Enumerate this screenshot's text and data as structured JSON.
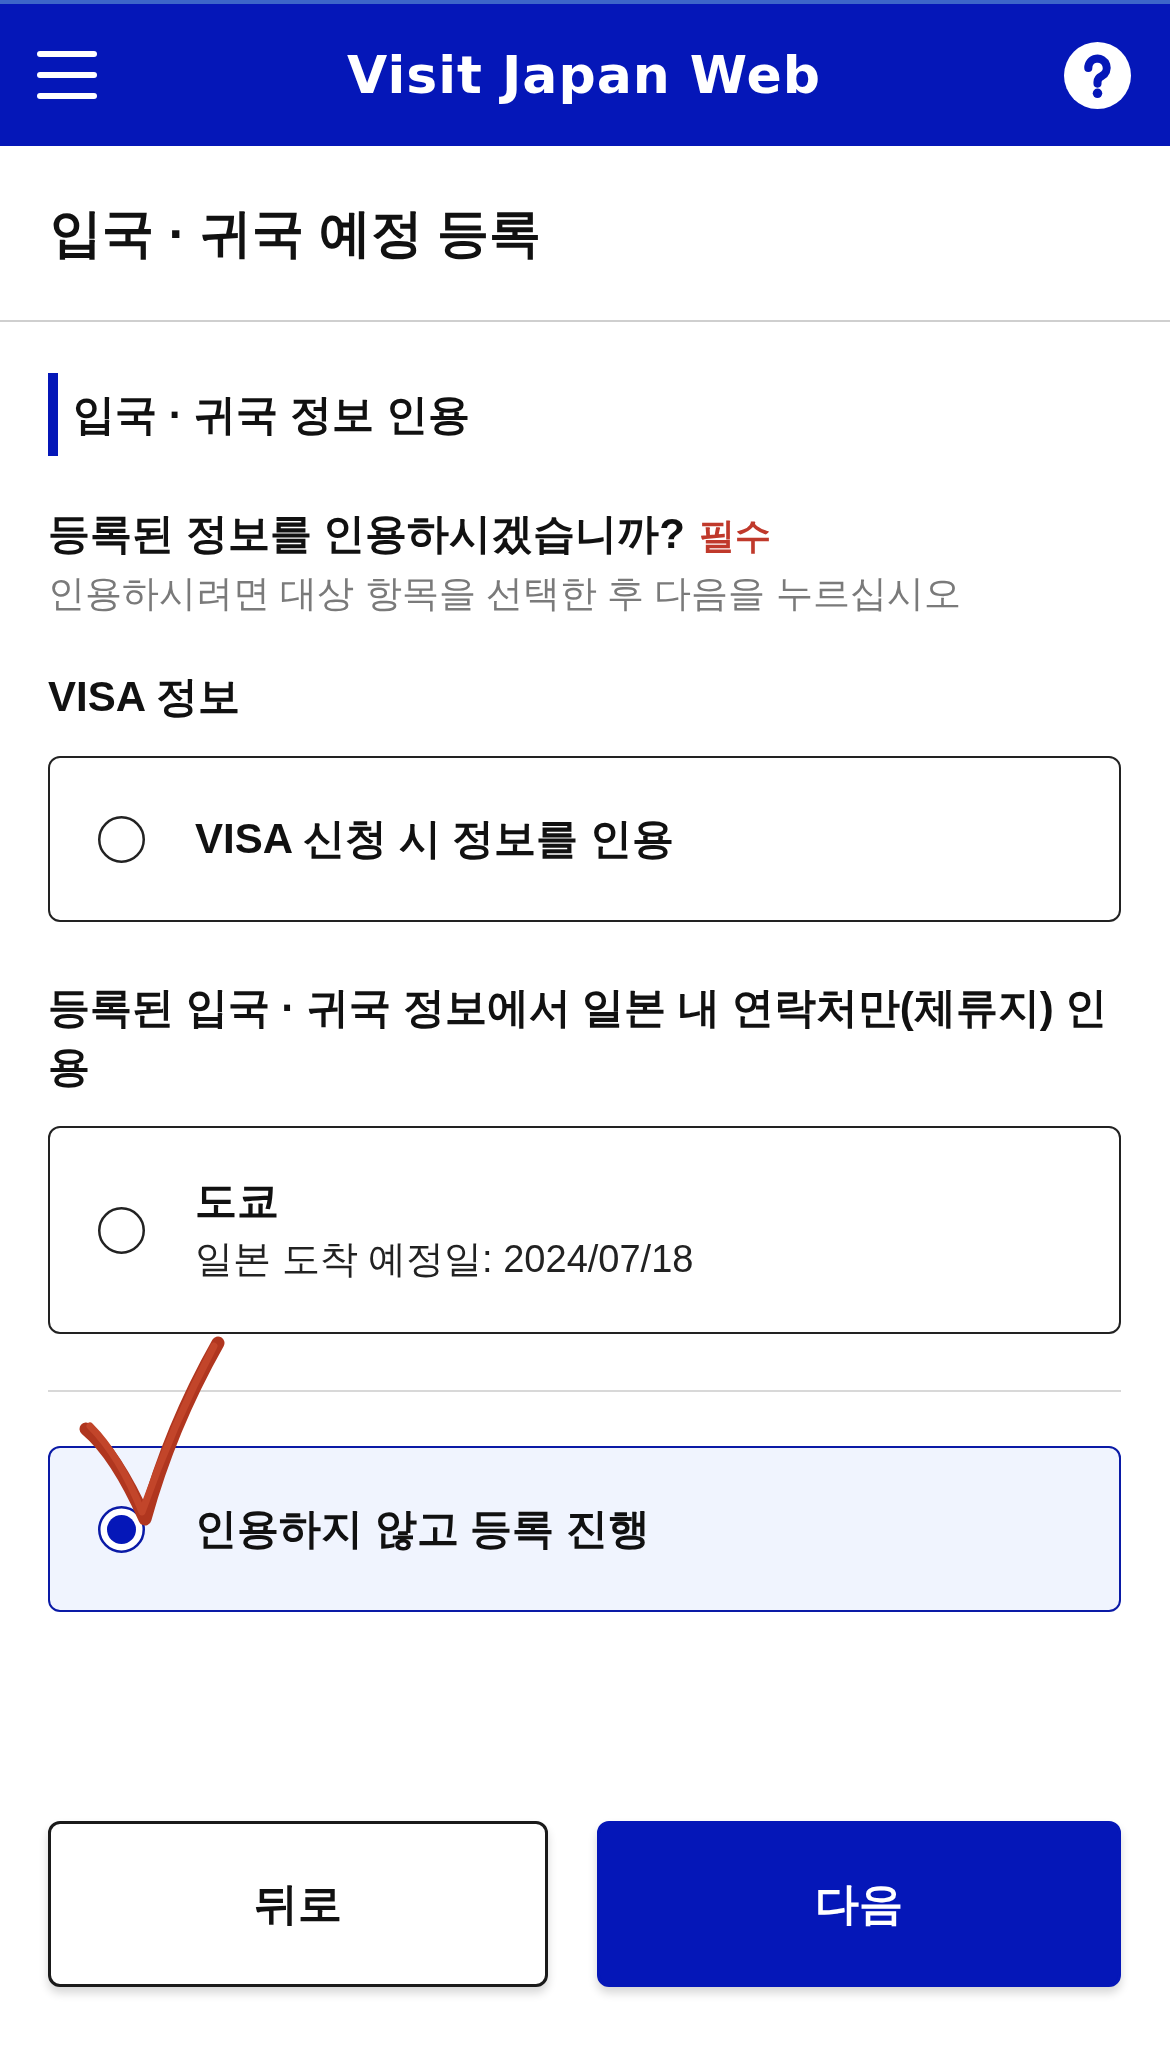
{
  "header": {
    "title": "Visit Japan Web"
  },
  "page_title": "입국 · 귀국 예정 등록",
  "section": {
    "heading": "입국 · 귀국 정보 인용",
    "question": "등록된 정보를 인용하시겠습니까?",
    "required_label": "필수",
    "hint": "인용하시려면 대상 항목을 선택한 후 다음을 누르십시오"
  },
  "groups": [
    {
      "label": "VISA 정보",
      "options": [
        {
          "title": "VISA 신청 시 정보를 인용",
          "selected": false
        }
      ]
    },
    {
      "label": "등록된 입국 · 귀국 정보에서 일본 내 연락처만(체류지) 인용",
      "options": [
        {
          "title": "도쿄",
          "detail": "일본 도착 예정일: 2024/07/18",
          "selected": false
        }
      ]
    }
  ],
  "skip_option": {
    "title": "인용하지 않고 등록 진행",
    "selected": true
  },
  "buttons": [
    {
      "label": "뒤로",
      "kind": "secondary"
    },
    {
      "label": "다음",
      "kind": "primary"
    }
  ]
}
